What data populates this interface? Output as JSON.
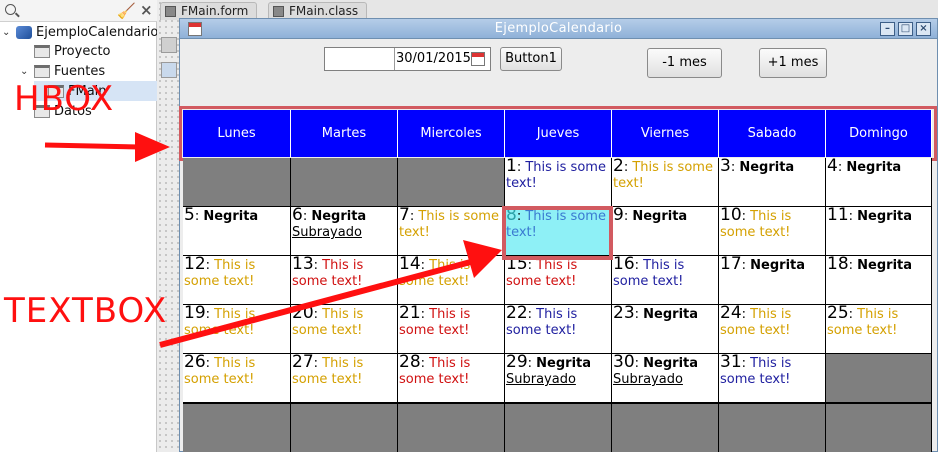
{
  "tree": {
    "root_label": "EjemploCalendario",
    "items": [
      {
        "label": "Proyecto"
      },
      {
        "label": "Fuentes"
      },
      {
        "label": "FMain"
      },
      {
        "label": "Datos"
      }
    ]
  },
  "tabs": [
    {
      "label": "FMain.form"
    },
    {
      "label": "FMain.class"
    }
  ],
  "window": {
    "title": "EjemploCalendario",
    "date_value": "30/01/2015",
    "button1_label": "Button1",
    "prev_month_label": "-1 mes",
    "next_month_label": "+1 mes"
  },
  "headers": [
    "Lunes",
    "Martes",
    "Miercoles",
    "Jueves",
    "Viernes",
    "Sabado",
    "Domingo"
  ],
  "cells": [
    {
      "empty": true
    },
    {
      "empty": true
    },
    {
      "empty": true
    },
    {
      "day": "1",
      "text": "This is some text!",
      "color": "#2020a0"
    },
    {
      "day": "2",
      "text": "This is some text!",
      "color": "#d4a000"
    },
    {
      "day": "3",
      "bold": "Negrita"
    },
    {
      "day": "4",
      "bold": "Negrita"
    },
    {
      "day": "5",
      "bold": "Negrita"
    },
    {
      "day": "6",
      "bold": "Negrita",
      "under": "Subrayado"
    },
    {
      "day": "7",
      "text": "This is some text!",
      "color": "#d4a000"
    },
    {
      "day": "8",
      "text": "This is some text!",
      "color": "#3a7ad0",
      "highlight": true
    },
    {
      "day": "9",
      "bold": "Negrita"
    },
    {
      "day": "10",
      "text": "This is some text!",
      "color": "#d4a000"
    },
    {
      "day": "11",
      "bold": "Negrita"
    },
    {
      "day": "12",
      "text": "This is some text!",
      "color": "#d4a000"
    },
    {
      "day": "13",
      "text": "This is some text!",
      "color": "#d01010"
    },
    {
      "day": "14",
      "text": "This is some text!",
      "color": "#d4a000"
    },
    {
      "day": "15",
      "text": "This is some text!",
      "color": "#d01010"
    },
    {
      "day": "16",
      "text": "This is some text!",
      "color": "#2020a0"
    },
    {
      "day": "17",
      "bold": "Negrita"
    },
    {
      "day": "18",
      "bold": "Negrita"
    },
    {
      "day": "19",
      "text": "This is some text!",
      "color": "#d4a000"
    },
    {
      "day": "20",
      "text": "This is some text!",
      "color": "#d4a000"
    },
    {
      "day": "21",
      "text": "This is some text!",
      "color": "#d01010"
    },
    {
      "day": "22",
      "text": "This is some text!",
      "color": "#2020a0"
    },
    {
      "day": "23",
      "bold": "Negrita"
    },
    {
      "day": "24",
      "text": "This is some text!",
      "color": "#d4a000"
    },
    {
      "day": "25",
      "text": "This is some text!",
      "color": "#d4a000"
    },
    {
      "day": "26",
      "text": "This is some text!",
      "color": "#d4a000"
    },
    {
      "day": "27",
      "text": "This is some text!",
      "color": "#d4a000"
    },
    {
      "day": "28",
      "text": "This is some text!",
      "color": "#d01010"
    },
    {
      "day": "29",
      "bold": "Negrita",
      "under": "Subrayado"
    },
    {
      "day": "30",
      "bold": "Negrita",
      "under": "Subrayado"
    },
    {
      "day": "31",
      "text": "This is some text!",
      "color": "#2020a0"
    },
    {
      "empty": true
    }
  ],
  "annotations": {
    "hbox_label": "HBOX",
    "textbox_label": "TEXTBOX",
    "color": "#ff1010"
  }
}
